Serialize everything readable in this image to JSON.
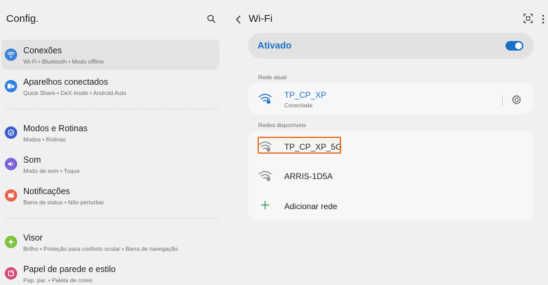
{
  "left": {
    "title": "Config.",
    "items": [
      {
        "title": "Conexões",
        "subtitle": "Wi-Fi  •  Bluetooth  •  Modo offline",
        "icon": "wifi-icon",
        "color": "#3b82d6"
      },
      {
        "title": "Aparelhos conectados",
        "subtitle": "Quick Share  •  DeX mode  •  Android Auto",
        "icon": "devices-icon",
        "color": "#2e7fe0"
      },
      {
        "title": "Modos e Rotinas",
        "subtitle": "Modos  •  Rotinas",
        "icon": "check-circle-icon",
        "color": "#3b5bcc"
      },
      {
        "title": "Som",
        "subtitle": "Modo de som  •  Toque",
        "icon": "volume-icon",
        "color": "#7c63d6"
      },
      {
        "title": "Notificações",
        "subtitle": "Barra de status  •  Não perturbar",
        "icon": "bell-icon",
        "color": "#e8654e"
      },
      {
        "title": "Visor",
        "subtitle": "Brilho  •  Proteção para conforto ocular  •  Barra de navegação",
        "icon": "sun-icon",
        "color": "#7cc23a"
      },
      {
        "title": "Papel de parede e estilo",
        "subtitle": "Pap. par.  •  Paleta de cores",
        "icon": "palette-icon",
        "color": "#d44a7a"
      }
    ]
  },
  "right": {
    "title": "Wi-Fi",
    "toggle_label": "Ativado",
    "toggle_on": true,
    "current_label": "Rede atual",
    "current": {
      "name": "TP_CP_XP",
      "status": "Conectada"
    },
    "available_label": "Redes disponíveis",
    "available": [
      {
        "name": "TP_CP_XP_5G"
      },
      {
        "name": "ARRIS-1D5A"
      }
    ],
    "add_label": "Adicionar rede"
  },
  "colors": {
    "accent": "#1a6fc9",
    "highlight": "#e8782c",
    "add": "#2e9e4f"
  }
}
